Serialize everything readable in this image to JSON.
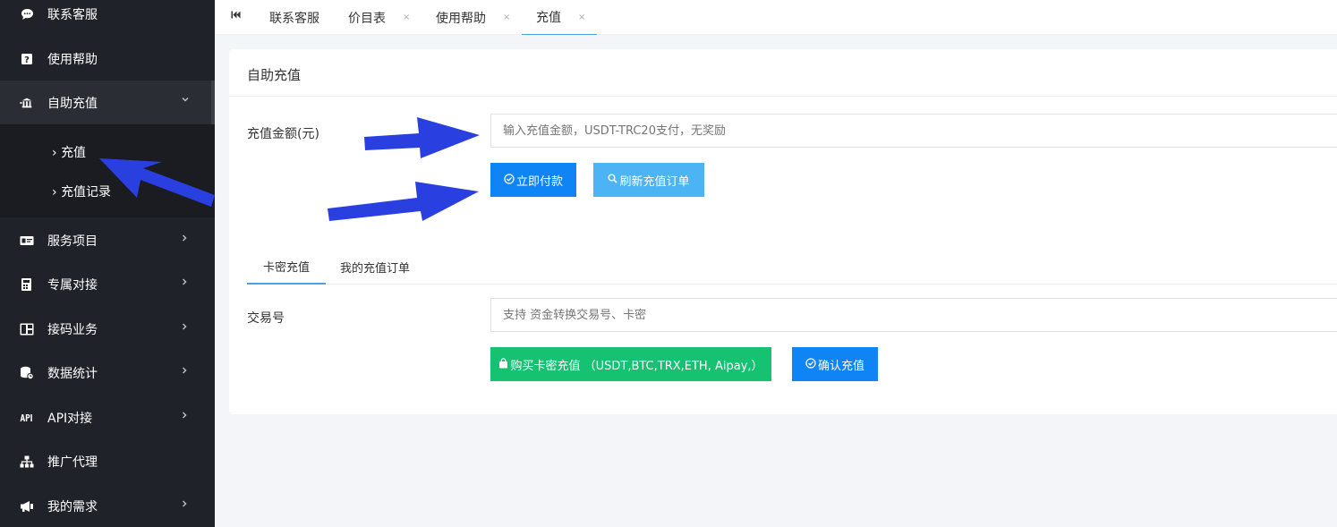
{
  "sidebar": {
    "items": [
      {
        "label": "联系客服",
        "icon": "chat-bubble-icon"
      },
      {
        "label": "使用帮助",
        "icon": "help-icon"
      },
      {
        "label": "自助充值",
        "icon": "bank-icon",
        "expanded": true
      },
      {
        "label": "服务项目",
        "icon": "card-icon"
      },
      {
        "label": "专属对接",
        "icon": "book-icon"
      },
      {
        "label": "接码业务",
        "icon": "calculator-icon"
      },
      {
        "label": "数据统计",
        "icon": "database-icon"
      },
      {
        "label": "API对接",
        "icon": "api-icon"
      },
      {
        "label": "推广代理",
        "icon": "sitemap-icon"
      },
      {
        "label": "我的需求",
        "icon": "megaphone-icon"
      }
    ],
    "sub_items": [
      {
        "label": "充值",
        "active": true
      },
      {
        "label": "充值记录"
      }
    ]
  },
  "tabs": [
    {
      "label": "联系客服",
      "closable": false
    },
    {
      "label": "价目表",
      "closable": true
    },
    {
      "label": "使用帮助",
      "closable": true
    },
    {
      "label": "充值",
      "closable": true,
      "active": true
    }
  ],
  "tab_close_glyph": "×",
  "card": {
    "title": "自助充值",
    "amount_label": "充值金额(元)",
    "amount_placeholder": "输入充值金额，USDT-TRC20支付，无奖励",
    "pay_button": "立即付款",
    "refresh_button": "刷新充值订单",
    "subtabs": [
      "卡密充值",
      "我的充值订单"
    ],
    "txn_label": "交易号",
    "txn_placeholder": "支持 资金转换交易号、卡密",
    "buy_card_button": "购买卡密充值 （USDT,BTC,TRX,ETH, Aipay,）",
    "confirm_button": "确认充值"
  },
  "colors": {
    "sidebar_bg": "#20222a",
    "primary": "#0e84f5",
    "light_blue": "#4cb3f5",
    "green": "#16c172",
    "arrow": "#2a3fe0"
  }
}
